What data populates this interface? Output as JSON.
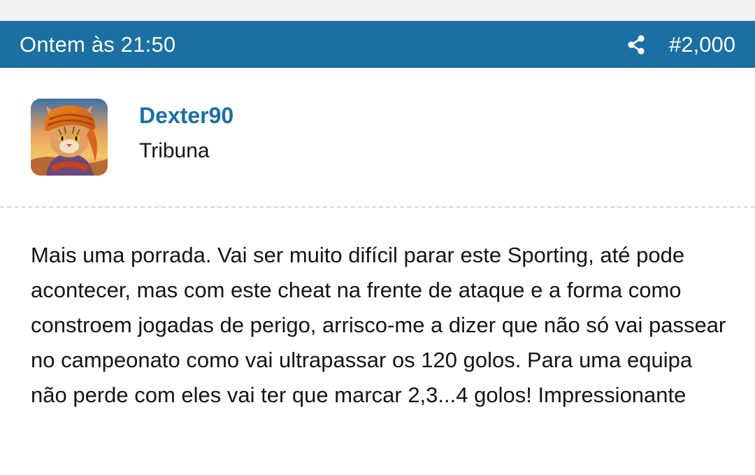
{
  "header": {
    "timestamp": "Ontem às 21:50",
    "post_number": "#2,000",
    "share_icon": "share-icon",
    "background_color": "#1a6fa3"
  },
  "user": {
    "name": "Dexter90",
    "title": "Tribuna",
    "avatar_icon": "cat-with-orange-turban-avatar",
    "name_color": "#1a6fa3"
  },
  "message": {
    "text": "Mais uma porrada. Vai ser muito difícil parar este Sporting, até pode acontecer, mas com este cheat na frente de ataque e a forma como constroem jogadas de perigo, arrisco-me a dizer que não só vai passear no campeonato como vai ultrapassar os 120 golos. Para uma equipa não perde com eles vai ter que marcar 2,3...4 golos! Impressionante"
  }
}
